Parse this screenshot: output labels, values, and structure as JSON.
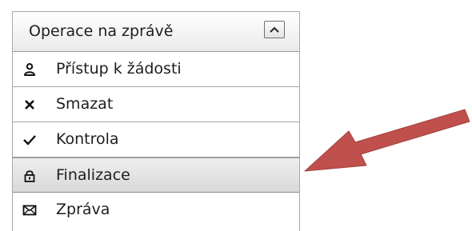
{
  "panel": {
    "title": "Operace na zprávě",
    "collapse_icon": "chevron-up-icon"
  },
  "menu": {
    "items": [
      {
        "label": "Přístup k žádosti",
        "icon": "person-icon"
      },
      {
        "label": "Smazat",
        "icon": "cross-icon"
      },
      {
        "label": "Kontrola",
        "icon": "checkmark-icon"
      },
      {
        "label": "Finalizace",
        "icon": "lock-icon",
        "selected": true
      },
      {
        "label": "Zpráva",
        "icon": "envelope-icon"
      }
    ]
  },
  "annotation": {
    "arrow_color": "#c0504d",
    "points_to": "Finalizace"
  }
}
